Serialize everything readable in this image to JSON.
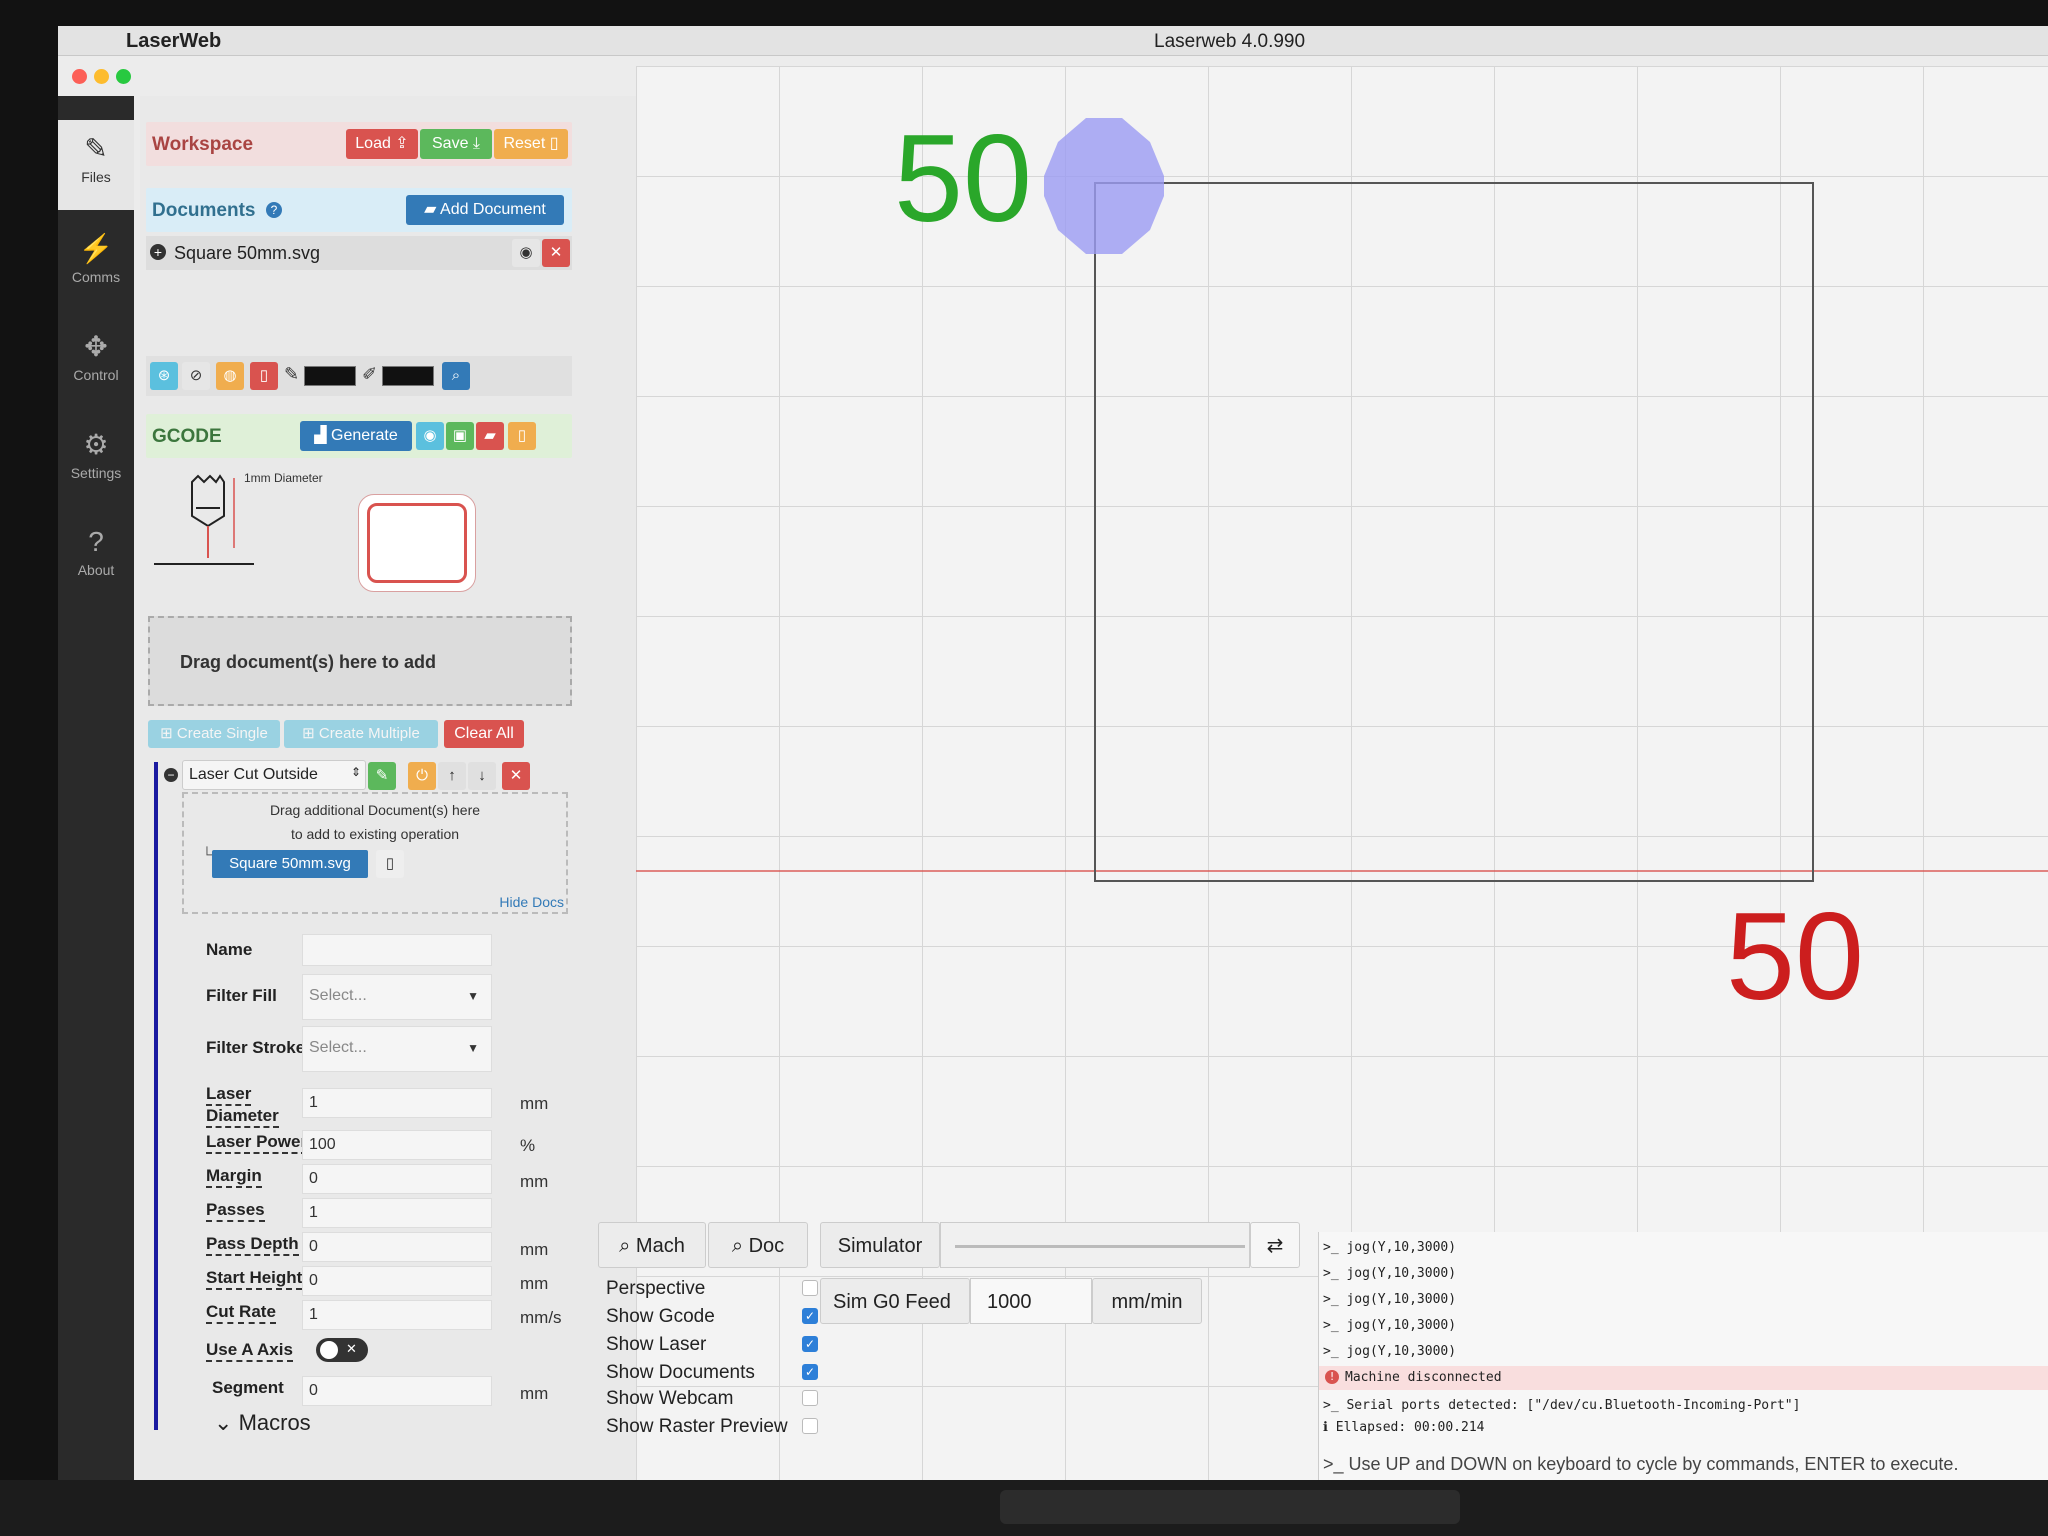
{
  "titlebar": {
    "app_name": "LaserWeb",
    "window_title": "Laserweb 4.0.990"
  },
  "nav": [
    {
      "label": "Files",
      "icon": "edit-icon"
    },
    {
      "label": "Comms",
      "icon": "plug-icon"
    },
    {
      "label": "Control",
      "icon": "arrows-icon"
    },
    {
      "label": "Settings",
      "icon": "gear-icon"
    },
    {
      "label": "About",
      "icon": "question-icon"
    }
  ],
  "workspace": {
    "title": "Workspace",
    "load": "Load",
    "save": "Save",
    "reset": "Reset"
  },
  "documents": {
    "title": "Documents",
    "add": "Add Document",
    "item": "Square 50mm.svg"
  },
  "gcode": {
    "title": "GCODE",
    "generate": "Generate",
    "diagram_label": "1mm Diameter"
  },
  "drop_zone": "Drag document(s) here to add",
  "ops_buttons": {
    "create_single": "Create Single",
    "create_multiple": "Create Multiple",
    "clear_all": "Clear All"
  },
  "operation": {
    "type": "Laser Cut Outside",
    "drag_hint_1": "Drag additional Document(s) here",
    "drag_hint_2": "to add to existing operation",
    "doc": "Square 50mm.svg",
    "hide_docs": "Hide Docs",
    "name_label": "Name",
    "filter_fill_label": "Filter Fill",
    "filter_fill_value": "Select...",
    "filter_stroke_label": "Filter Stroke",
    "filter_stroke_value": "Select...",
    "laser_diameter_label_1": "Laser",
    "laser_diameter_label_2": "Diameter",
    "laser_diameter": "1",
    "laser_diameter_unit": "mm",
    "laser_power_label": "Laser Power",
    "laser_power": "100",
    "laser_power_unit": "%",
    "margin_label": "Margin",
    "margin": "0",
    "margin_unit": "mm",
    "passes_label": "Passes",
    "passes": "1",
    "pass_depth_label": "Pass Depth",
    "pass_depth": "0",
    "pass_depth_unit": "mm",
    "start_height_label": "Start Height",
    "start_height": "0",
    "start_height_unit": "mm",
    "cut_rate_label": "Cut Rate",
    "cut_rate": "1",
    "cut_rate_unit": "mm/s",
    "use_a_axis_label": "Use A Axis",
    "segment_label": "Segment",
    "segment": "0",
    "segment_unit": "mm",
    "macros": "Macros"
  },
  "canvas": {
    "top_label": "50",
    "right_label": "50"
  },
  "view": {
    "mach": "Mach",
    "doc": "Doc",
    "options": [
      {
        "label": "Perspective",
        "checked": false
      },
      {
        "label": "Show Gcode",
        "checked": true
      },
      {
        "label": "Show Laser",
        "checked": true
      },
      {
        "label": "Show Documents",
        "checked": true
      },
      {
        "label": "Show Webcam",
        "checked": false
      },
      {
        "label": "Show Raster Preview",
        "checked": false
      }
    ]
  },
  "simulator": {
    "label": "Simulator",
    "feed_label": "Sim G0 Feed",
    "feed_value": "1000",
    "feed_unit": "mm/min"
  },
  "console": {
    "lines": [
      ">_ jog(Y,10,3000)",
      ">_ jog(Y,10,3000)",
      ">_ jog(Y,10,3000)",
      ">_ jog(Y,10,3000)",
      ">_ jog(Y,10,3000)"
    ],
    "error": "Machine disconnected",
    "serial": ">_ Serial ports detected: [\"/dev/cu.Bluetooth-Incoming-Port\"]",
    "elapsed": "Ellapsed: 00:00.214",
    "hint": ">_ Use UP and DOWN on keyboard to cycle by commands, ENTER to execute."
  }
}
